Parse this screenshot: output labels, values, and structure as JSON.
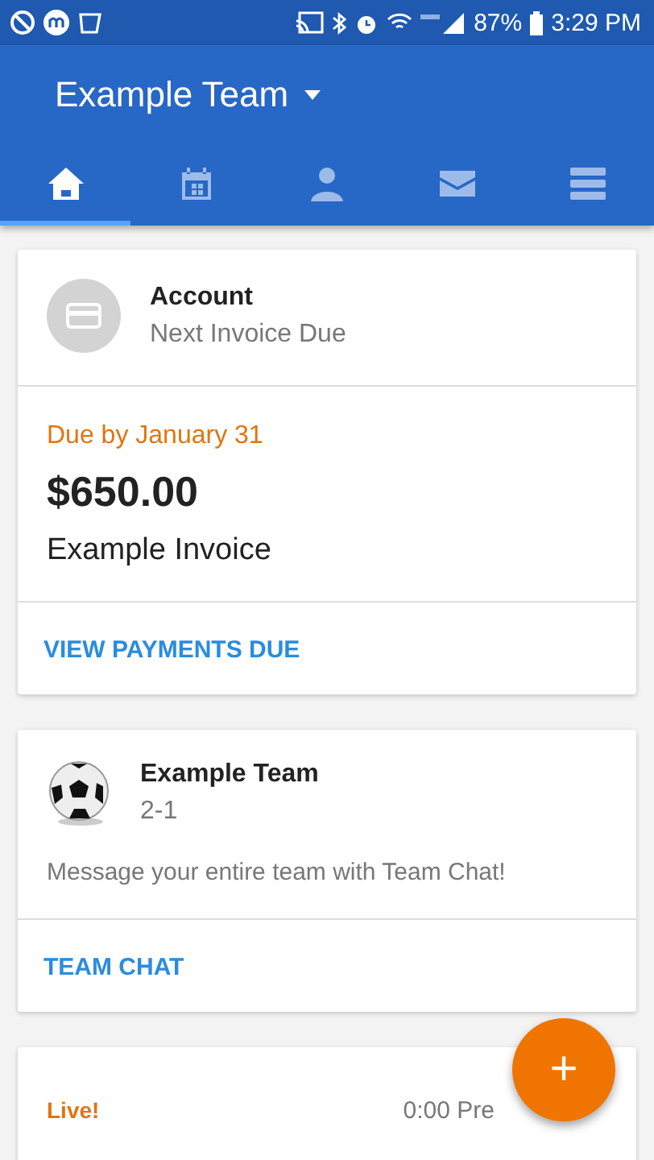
{
  "status_bar": {
    "battery": "87%",
    "time": "3:29 PM"
  },
  "header": {
    "title": "Example Team"
  },
  "tabs": [
    {
      "kind": "home",
      "selected": true
    },
    {
      "kind": "calendar",
      "selected": false
    },
    {
      "kind": "person",
      "selected": false
    },
    {
      "kind": "mail",
      "selected": false
    },
    {
      "kind": "menu",
      "selected": false
    }
  ],
  "invoice_card": {
    "title": "Account",
    "subtitle": "Next Invoice Due",
    "due": "Due by January 31",
    "amount": "$650.00",
    "description": "Example Invoice",
    "action": "VIEW PAYMENTS DUE"
  },
  "team_card": {
    "name": "Example Team",
    "record": "2-1",
    "message": "Message your entire team with Team Chat!",
    "action": "TEAM CHAT"
  },
  "game_card": {
    "status": "Live!",
    "clock": "0:00 Pre"
  },
  "fab": {
    "label": "+"
  }
}
